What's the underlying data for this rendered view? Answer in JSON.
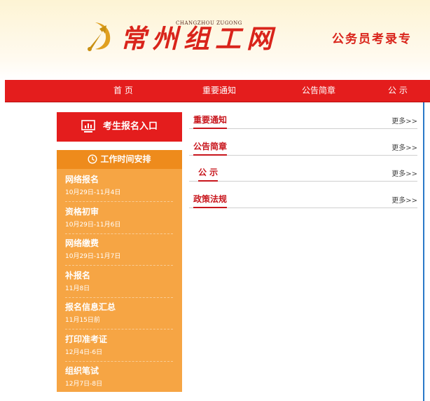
{
  "header": {
    "site_name": "常州组工网",
    "site_pinyin": "CHANGZHOU ZUGONG",
    "slogan": "公务员考录专",
    "emblem_icon": "party-emblem-icon"
  },
  "nav": {
    "items": [
      {
        "label": "首 页"
      },
      {
        "label": "重要通知"
      },
      {
        "label": "公告简章"
      },
      {
        "label": "公 示"
      }
    ]
  },
  "sidebar": {
    "enroll": {
      "label": "考生报名入口",
      "icon": "monitor-chart-icon"
    },
    "schedule": {
      "title": "工作时间安排",
      "icon": "clock-icon",
      "items": [
        {
          "name": "网络报名",
          "date": "10月29日-11月4日"
        },
        {
          "name": "资格初审",
          "date": "10月29日-11月6日"
        },
        {
          "name": "网络缴费",
          "date": "10月29日-11月7日"
        },
        {
          "name": "补报名",
          "date": "11月8日"
        },
        {
          "name": "报名信息汇总",
          "date": "11月15日前"
        },
        {
          "name": "打印准考证",
          "date": "12月4日-6日"
        },
        {
          "name": "组织笔试",
          "date": "12月7日-8日"
        }
      ]
    }
  },
  "sections": [
    {
      "title": "重要通知",
      "more": "更多>>"
    },
    {
      "title": "公告简章",
      "more": "更多>>"
    },
    {
      "title": "公 示",
      "more": "更多>>"
    },
    {
      "title": "政策法规",
      "more": "更多>>"
    }
  ],
  "colors": {
    "brand_red": "#e41d1d",
    "schedule_orange": "#f6a544",
    "schedule_header": "#ee8b1c"
  }
}
